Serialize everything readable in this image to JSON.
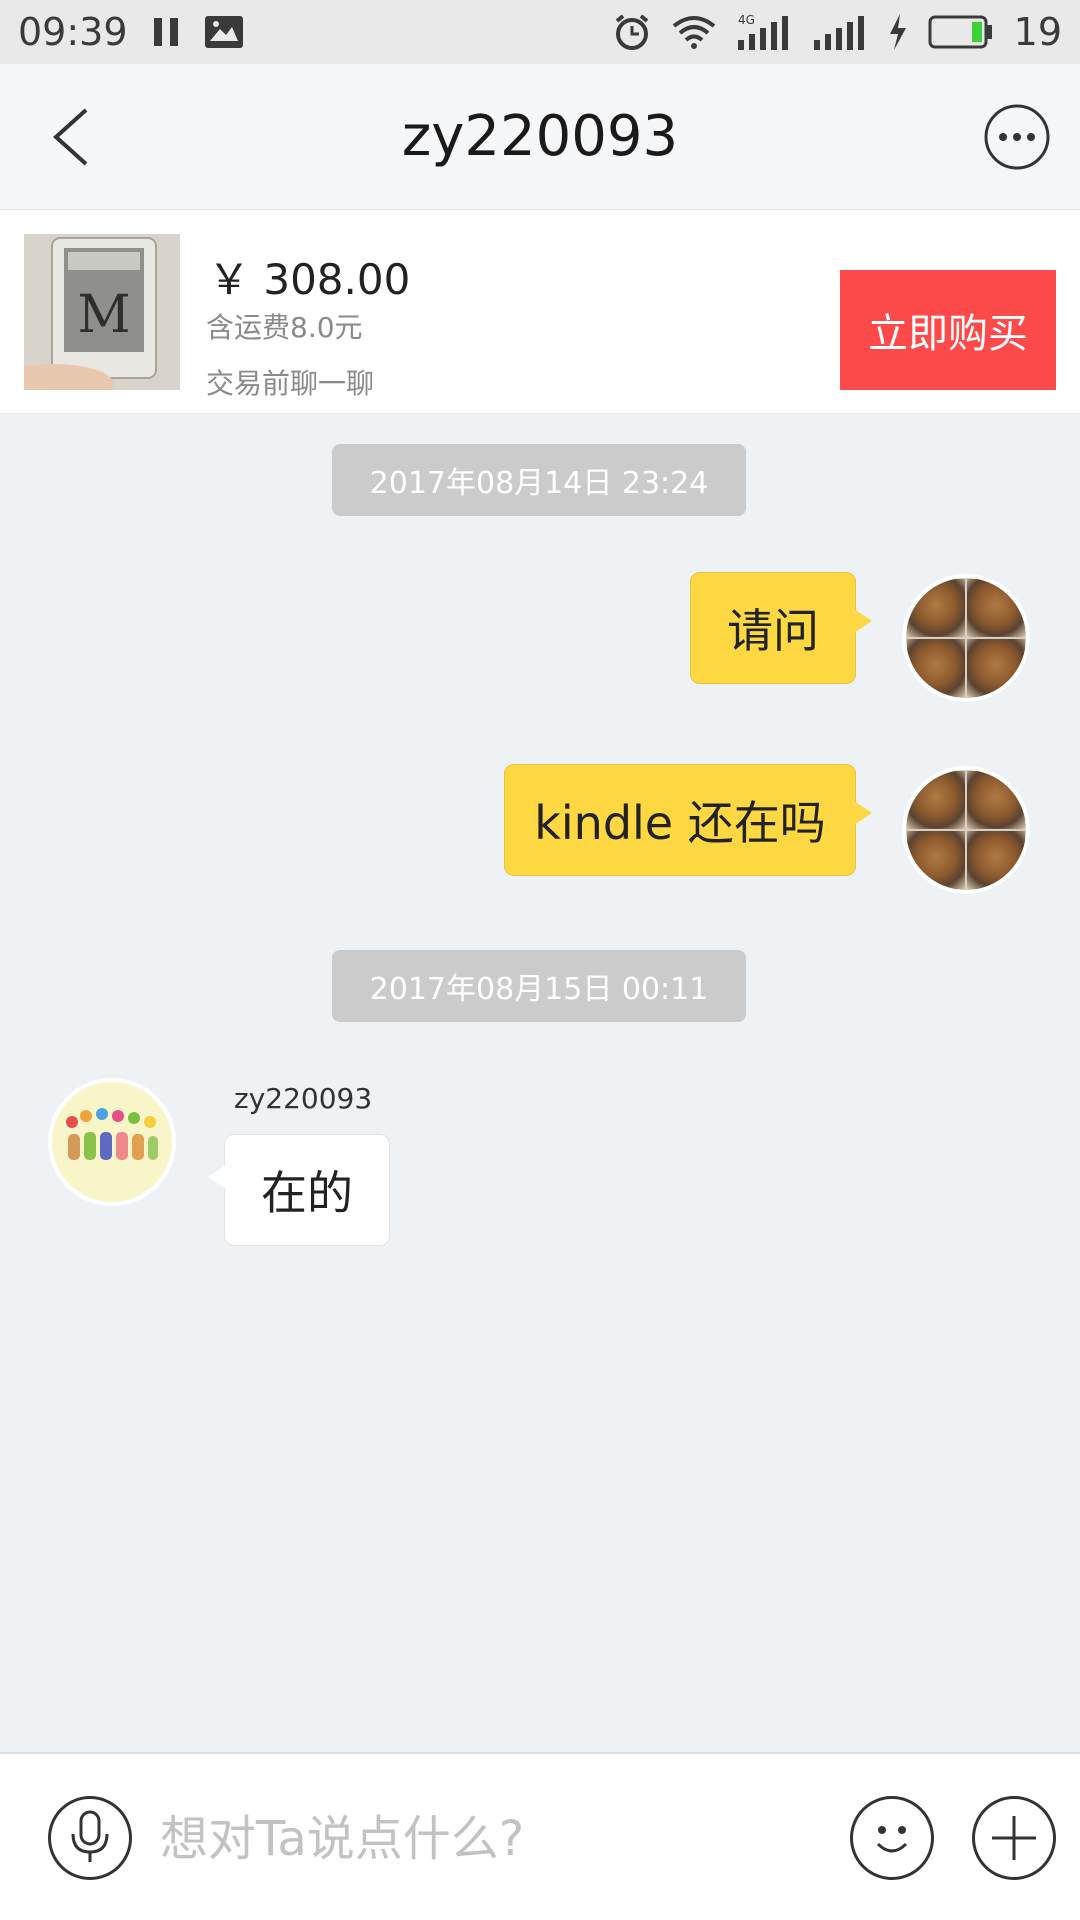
{
  "status_bar": {
    "time": "09:39",
    "battery_level": "19",
    "network": "4G"
  },
  "nav": {
    "title": "zy220093"
  },
  "product": {
    "price": "￥ 308.00",
    "shipping": "含运费8.0元",
    "chat_hint": "交易前聊一聊",
    "buy_label": "立即购买"
  },
  "messages": [
    {
      "type": "time",
      "text": "2017年08月14日 23:24"
    },
    {
      "type": "outgoing",
      "text": "请问"
    },
    {
      "type": "outgoing",
      "text": "kindle 还在吗"
    },
    {
      "type": "time",
      "text": "2017年08月15日 00:11"
    },
    {
      "type": "incoming",
      "sender": "zy220093",
      "text": "在的"
    }
  ],
  "input": {
    "placeholder": "想对Ta说点什么?"
  },
  "colors": {
    "accent_buy": "#fc4a4a",
    "bubble_out": "#fdd843",
    "time_chip": "#cbcbcb",
    "background": "#eff2f5"
  },
  "icons": {
    "back": "chevron-left-icon",
    "more": "more-dots-icon",
    "voice": "microphone-icon",
    "emoji": "smiley-icon",
    "add": "plus-icon"
  }
}
